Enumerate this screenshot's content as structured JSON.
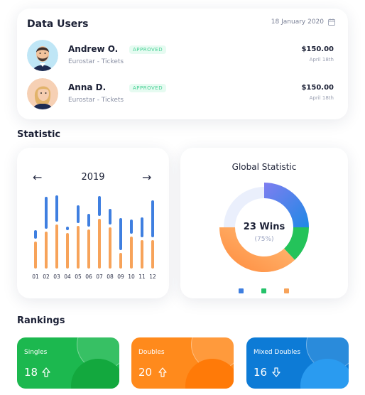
{
  "users_card": {
    "title": "Data Users",
    "date": "18 January 2020",
    "users": [
      {
        "name": "Andrew O.",
        "status": "APPROVED",
        "subtitle": "Eurostar - Tickets",
        "amount": "$150.00",
        "amount_date": "April 18th"
      },
      {
        "name": "Anna D.",
        "status": "APPROVED",
        "subtitle": "Eurostar - Tickets",
        "amount": "$150.00",
        "amount_date": "April 18th"
      }
    ]
  },
  "statistic": {
    "title": "Statistic",
    "year_card": {
      "year": "2019",
      "prev_icon": "arrow-left-icon",
      "next_icon": "arrow-right-icon"
    },
    "global_card": {
      "title": "Global Statistic",
      "center_value": "23 Wins",
      "center_sub": "(75%)"
    }
  },
  "rankings": {
    "title": "Rankings",
    "cards": [
      {
        "label": "Singles",
        "value": "18",
        "icon": "arrow-up-icon"
      },
      {
        "label": "Doubles",
        "value": "20",
        "icon": "arrow-up-icon"
      },
      {
        "label": "Mixed Doubles",
        "value": "16",
        "icon": "arrow-down-icon"
      }
    ]
  },
  "colors": {
    "blue": "#3f7fe0",
    "orange": "#f7a35a",
    "green": "#25c26a",
    "green_card": "#1cb84f",
    "orange_card": "#ff8a1c",
    "blue_card": "#0d7bd6",
    "badge_green": "#44cf93"
  },
  "chart_data": [
    {
      "type": "bar",
      "title": "2019",
      "categories": [
        "01",
        "02",
        "03",
        "04",
        "05",
        "06",
        "07",
        "08",
        "09",
        "10",
        "11",
        "12"
      ],
      "series": [
        {
          "values": [
            0.38,
            0.52,
            0.62,
            0.5,
            0.6,
            0.55,
            0.7,
            0.58,
            0.22,
            0.45,
            0.4,
            0.4
          ]
        },
        {
          "values": [
            0.12,
            0.45,
            0.37,
            0.05,
            0.25,
            0.18,
            0.28,
            0.22,
            0.45,
            0.2,
            0.28,
            0.52
          ]
        }
      ]
    },
    {
      "type": "pie",
      "title": "Global Statistic",
      "categories": [
        "blue",
        "green",
        "orange",
        "remaining"
      ],
      "values": [
        25,
        13,
        37,
        25
      ]
    }
  ]
}
